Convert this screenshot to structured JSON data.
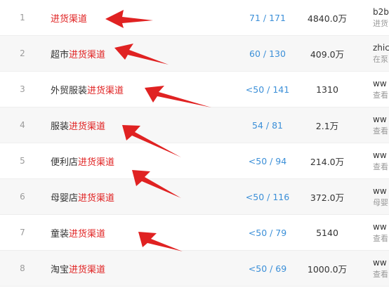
{
  "rows": [
    {
      "rank": "1",
      "prefix": "",
      "highlight": "进货渠道",
      "suffix": "",
      "ratio": "71 / 171",
      "volume": "4840.0万",
      "site_url": "b2b",
      "site_desc": "进货"
    },
    {
      "rank": "2",
      "prefix": "超市",
      "highlight": "进货渠道",
      "suffix": "",
      "ratio": "60 / 130",
      "volume": "409.0万",
      "site_url": "zhic",
      "site_desc": "在泵"
    },
    {
      "rank": "3",
      "prefix": "外贸服装",
      "highlight": "进货渠道",
      "suffix": "",
      "ratio": "<50 / 141",
      "volume": "1310",
      "site_url": "ww",
      "site_desc": "查看"
    },
    {
      "rank": "4",
      "prefix": "服装",
      "highlight": "进货渠道",
      "suffix": "",
      "ratio": "54 / 81",
      "volume": "2.1万",
      "site_url": "ww",
      "site_desc": "查看"
    },
    {
      "rank": "5",
      "prefix": "便利店",
      "highlight": "进货渠道",
      "suffix": "",
      "ratio": "<50 / 94",
      "volume": "214.0万",
      "site_url": "ww",
      "site_desc": "查看"
    },
    {
      "rank": "6",
      "prefix": "母婴店",
      "highlight": "进货渠道",
      "suffix": "",
      "ratio": "<50 / 116",
      "volume": "372.0万",
      "site_url": "ww",
      "site_desc": "母婴"
    },
    {
      "rank": "7",
      "prefix": "童装",
      "highlight": "进货渠道",
      "suffix": "",
      "ratio": "<50 / 79",
      "volume": "5140",
      "site_url": "ww",
      "site_desc": "查看"
    },
    {
      "rank": "8",
      "prefix": "淘宝",
      "highlight": "进货渠道",
      "suffix": "",
      "ratio": "<50 / 69",
      "volume": "1000.0万",
      "site_url": "ww",
      "site_desc": "查看"
    }
  ],
  "colors": {
    "highlight": "#e02222",
    "link": "#3b8fd8",
    "arrow": "#e02222"
  },
  "annotation_icon": "red-arrow-icon"
}
